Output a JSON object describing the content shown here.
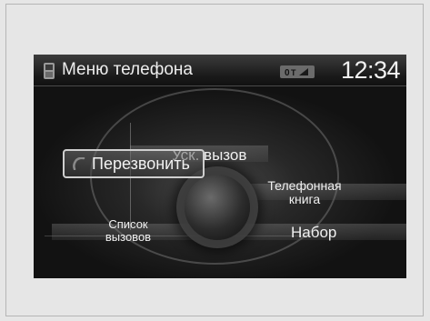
{
  "header": {
    "title": "Меню телефона",
    "clock": "12:34",
    "phone_icon": "phone-icon",
    "status_icon": "signal-status-icon"
  },
  "menu": {
    "quick_dial": "Уск. вызов",
    "redial": "Перезвонить",
    "redial_icon": "phone-handset-icon",
    "phonebook_line1": "Телефонная",
    "phonebook_line2": "книга",
    "call_history_line1": "Список",
    "call_history_line2": "вызовов",
    "dial": "Набор"
  },
  "colors": {
    "page_background": "#e6e6e6",
    "screen_background": "#101010",
    "text": "#f0f0f0",
    "selection_border": "#cfcfcf"
  }
}
